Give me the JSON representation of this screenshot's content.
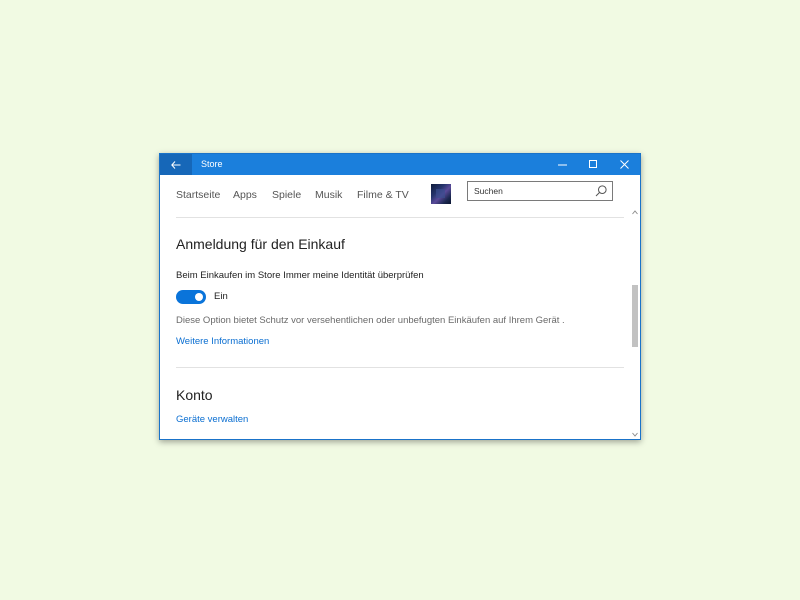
{
  "window": {
    "title": "Store",
    "accent": "#1b7fdc",
    "controls": [
      "minimize-icon",
      "maximize-icon",
      "close-icon"
    ]
  },
  "nav": {
    "items": [
      {
        "label": "Startseite"
      },
      {
        "label": "Apps"
      },
      {
        "label": "Spiele"
      },
      {
        "label": "Musik"
      },
      {
        "label": "Filme & TV"
      }
    ],
    "search": {
      "value": "Suchen",
      "icon": "search-icon"
    }
  },
  "purchase_section": {
    "heading": "Anmeldung für den Einkauf",
    "setting_label": "Beim Einkaufen im Store Immer meine Identität überprüfen",
    "toggle_state_label": "Ein",
    "toggle_on": true,
    "description": "Diese Option bietet Schutz vor versehentlichen oder unbefugten Einkäufen auf Ihrem Gerät .",
    "more_info_link": "Weitere Informationen"
  },
  "account_section": {
    "heading": "Konto",
    "manage_devices_link": "Geräte verwalten"
  },
  "colors": {
    "background": "#f1fae3",
    "link": "#0a6ed1",
    "toggle_on": "#0a74da"
  }
}
